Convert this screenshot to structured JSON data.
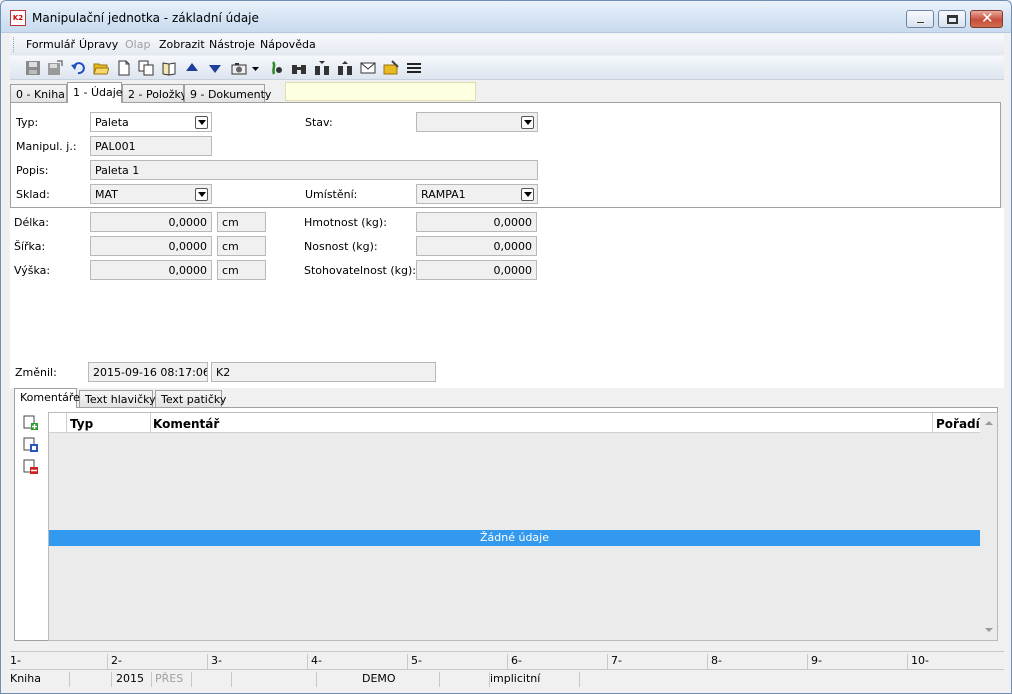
{
  "window": {
    "title": "Manipulační jednotka - základní údaje"
  },
  "menu": [
    "Formulář",
    "Úpravy",
    "Olap",
    "Zobrazit",
    "Nástroje",
    "Nápověda"
  ],
  "menu_disabled": [
    "Olap"
  ],
  "toolbar_icons": [
    "save-icon",
    "save-as-icon",
    "undo-icon",
    "open-folder-icon",
    "new-document-icon",
    "copy-icon",
    "book-icon",
    "arrow-up-icon",
    "arrow-down-icon",
    "camera-icon",
    "dropdown-icon",
    "filter-icon",
    "binoculars-icon",
    "binoculars-next-icon",
    "binoculars-prev-icon",
    "mail-icon",
    "edit-folder-icon",
    "menu-lines-icon"
  ],
  "tabs": [
    {
      "label": "0 - Kniha"
    },
    {
      "label": "1 - Údaje",
      "active": true
    },
    {
      "label": "2 - Položky"
    },
    {
      "label": "9 - Dokumenty"
    }
  ],
  "form": {
    "typ": {
      "label": "Typ:",
      "value": "Paleta"
    },
    "stav": {
      "label": "Stav:",
      "value": ""
    },
    "manipul": {
      "label": "Manipul. j.:",
      "value": "PAL001"
    },
    "popis": {
      "label": "Popis:",
      "value": "Paleta 1"
    },
    "sklad": {
      "label": "Sklad:",
      "value": "MAT"
    },
    "umisteni": {
      "label": "Umístění:",
      "value": "RAMPA1"
    },
    "delka": {
      "label": "Délka:",
      "value": "0,0000",
      "unit": "cm"
    },
    "sirka": {
      "label": "Šířka:",
      "value": "0,0000",
      "unit": "cm"
    },
    "vyska": {
      "label": "Výška:",
      "value": "0,0000",
      "unit": "cm"
    },
    "hmotnost": {
      "label": "Hmotnost (kg):",
      "value": "0,0000"
    },
    "nosnost": {
      "label": "Nosnost (kg):",
      "value": "0,0000"
    },
    "stohovatelnost": {
      "label": "Stohovatelnost (kg):",
      "value": "0,0000"
    },
    "zmenil": {
      "label": "Změnil:",
      "datetime": "2015-09-16 08:17:06",
      "user": "K2"
    }
  },
  "subtabs": [
    {
      "label": "Komentáře",
      "active": true
    },
    {
      "label": "Text hlavičky"
    },
    {
      "label": "Text patičky"
    }
  ],
  "grid": {
    "columns": [
      "Typ",
      "Komentář",
      "Pořadí"
    ],
    "empty_text": "Žádné údaje",
    "side_icons": [
      "add-record-icon",
      "edit-record-icon",
      "delete-record-icon"
    ]
  },
  "fkeys": [
    "1-",
    "2-",
    "3-",
    "4-",
    "5-",
    "6-",
    "7-",
    "8-",
    "9-",
    "10-"
  ],
  "status": {
    "book": "Kniha",
    "year": "2015",
    "pres": "PŘES",
    "db": "DEMO",
    "mode": "implicitní"
  },
  "colors": {
    "selection": "#3399ee",
    "highlight_field": "#ffffe1"
  }
}
